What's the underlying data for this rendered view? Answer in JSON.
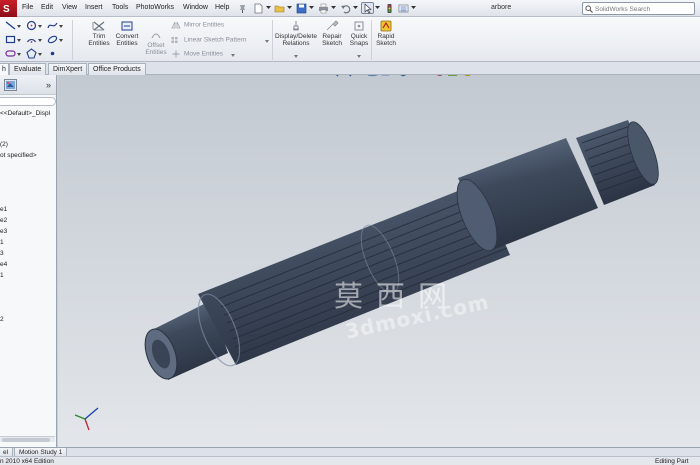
{
  "menubar": {
    "items": [
      "File",
      "Edit",
      "View",
      "Insert",
      "Tools",
      "PhotoWorks",
      "Window",
      "Help"
    ],
    "document_title": "arbore",
    "search_placeholder": "SolidWorks Search"
  },
  "sketch_tools": {
    "trim_entities": "Trim\nEntities",
    "convert_entities": "Convert\nEntities",
    "offset_entities": "Offset\nEntities",
    "mirror_entities": "Mirror Entities",
    "linear_sketch_pattern": "Linear Sketch Pattern",
    "move_entities": "Move Entities",
    "display_delete_relations": "Display/Delete\nRelations",
    "repair_sketch": "Repair\nSketch",
    "quick_snaps": "Quick\nSnaps",
    "rapid_sketch": "Rapid\nSketch"
  },
  "tabs": {
    "items": [
      "h",
      "Evaluate",
      "DimXpert",
      "Office Products"
    ]
  },
  "feature_tree": {
    "lines": [
      "<<Default>_Displ",
      "(2)",
      "ot specified>",
      "e1",
      "e2",
      "e3",
      "1",
      "3",
      "e4",
      "1",
      "2"
    ]
  },
  "bottom_tabs": {
    "items": [
      "el",
      "Motion Study 1"
    ]
  },
  "status": {
    "left": "n 2010 x64 Edition",
    "right": "Editing Part"
  },
  "watermark": {
    "cn": "莫西网",
    "url": "3dmoxi.com"
  },
  "colors": {
    "part_body": "#3e4a5c",
    "part_highlight": "#6b7890",
    "background_top": "#c3c9d1",
    "background_bottom": "#e3e6ea",
    "brand_red": "#c8202a"
  }
}
